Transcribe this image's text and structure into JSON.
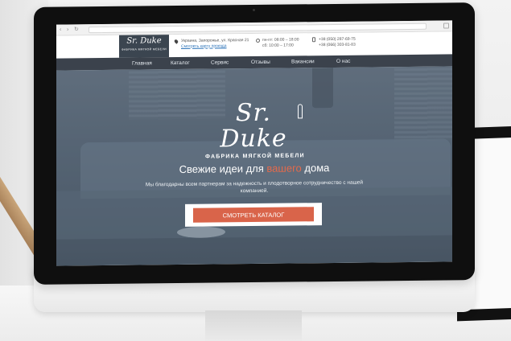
{
  "browser": {
    "back_glyph": "‹",
    "forward_glyph": "›",
    "reload_glyph": "↻"
  },
  "header": {
    "logo_script": "Sr. Duke",
    "logo_sub": "ФАБРИКА МЯГКОЙ МЕБЕЛИ",
    "address": "Украина, Запорожье, ул. Красная 21",
    "map_link": "Смотреть карту проезда",
    "hours_line1": "пн-пт: 08:00 – 18:00",
    "hours_line2": "сб: 10:00 – 17:00",
    "phone1": "+38 (050) 287-69-75",
    "phone2": "+38 (066) 303-81-83"
  },
  "nav": {
    "items": [
      "Главная",
      "Каталог",
      "Сервис",
      "Отзывы",
      "Вакансии",
      "О нас"
    ]
  },
  "hero": {
    "logo_script": "Sr. Duke",
    "logo_sub": "ФАБРИКА МЯГКОЙ МЕБЕЛИ",
    "headline_before": "Свежие идеи для ",
    "headline_accent": "вашего",
    "headline_after": " дома",
    "tagline": "Мы благодарны всем партнерам за надежность и плодотворное сотрудничество с нашей компанией.",
    "cta_label": "СМОТРЕТЬ КАТАЛОГ"
  },
  "colors": {
    "accent": "#d9644a",
    "nav_bg": "#303842",
    "logo_bg": "#3b4550"
  }
}
